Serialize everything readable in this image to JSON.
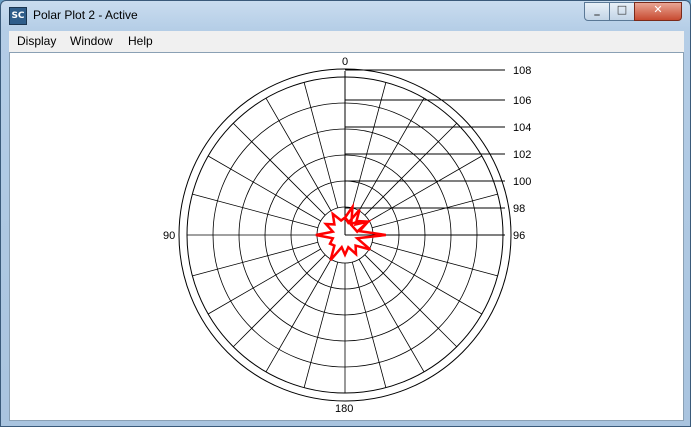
{
  "window": {
    "title": "Polar Plot 2 - Active",
    "icon_label": "SC"
  },
  "controls": {
    "minimize": "_",
    "maximize": "□",
    "close": "✕"
  },
  "menu": [
    "Display",
    "Window",
    "Help"
  ],
  "chart_data": {
    "type": "polar-line",
    "angle_labels": [
      "0",
      "90",
      "180"
    ],
    "radial_labels": [
      "108",
      "106",
      "104",
      "102",
      "100",
      "98",
      "96"
    ],
    "radial_range": [
      96,
      108
    ],
    "angles_deg": [
      -90,
      -75,
      -60,
      -45,
      -30,
      -15,
      0,
      15,
      30,
      45,
      60,
      75,
      90,
      105,
      120,
      135,
      150,
      165,
      180,
      195,
      210,
      225,
      240,
      255,
      270,
      285,
      300,
      315,
      330,
      345
    ],
    "series": [
      {
        "color": "#ff0000",
        "values": [
          96.4,
          96.9,
          96.2,
          96.5,
          96.8,
          96.3,
          97.4,
          96.2,
          96.9,
          96.3,
          96.6,
          96.2,
          96.5,
          96.2,
          96.9,
          96.3,
          96.4,
          96.2,
          96.9,
          96.2,
          96.6,
          96.3,
          96.7,
          96.3,
          96.4,
          96.2,
          96.9,
          96.3,
          96.8,
          96.2
        ]
      }
    ],
    "grid": true
  }
}
